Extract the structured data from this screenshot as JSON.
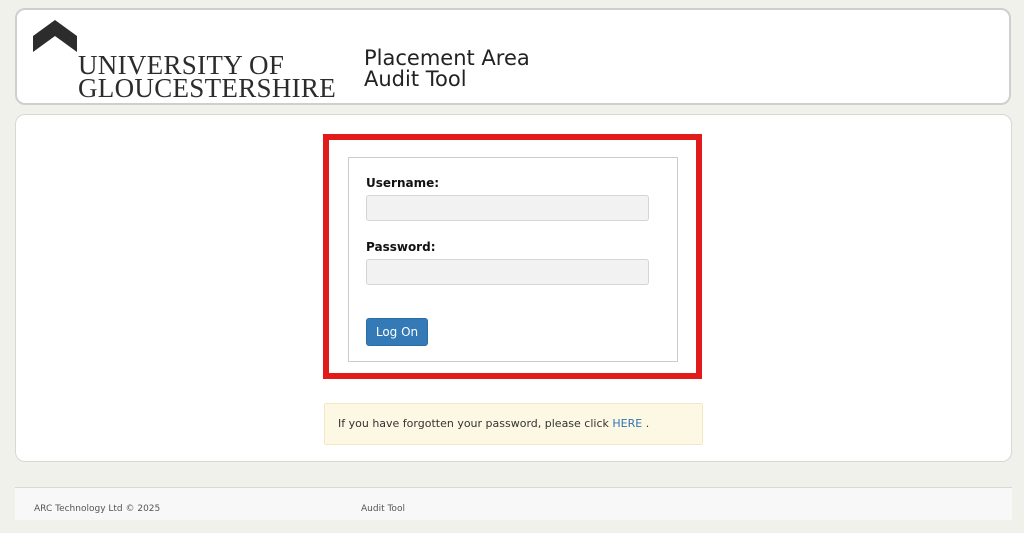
{
  "header": {
    "logo_line1": "UNIVERSITY OF",
    "logo_line2": "GLOUCESTERSHIRE",
    "app_title_line1": "Placement Area",
    "app_title_line2": "Audit Tool"
  },
  "login": {
    "username_label": "Username:",
    "username_value": "",
    "password_label": "Password:",
    "password_value": "",
    "submit_label": "Log On"
  },
  "notice": {
    "text_before": "If you have forgotten your password, please click ",
    "link_text": "HERE",
    "text_after": " ."
  },
  "footer": {
    "copyright": "ARC Technology Ltd © 2025",
    "app_name": "Audit Tool"
  },
  "icons": [
    "university-chevron-icon"
  ],
  "colors": {
    "highlight": "#e11b1b",
    "button": "#337ab7",
    "notice_bg": "#fcf8e3",
    "link": "#2f74b5"
  }
}
